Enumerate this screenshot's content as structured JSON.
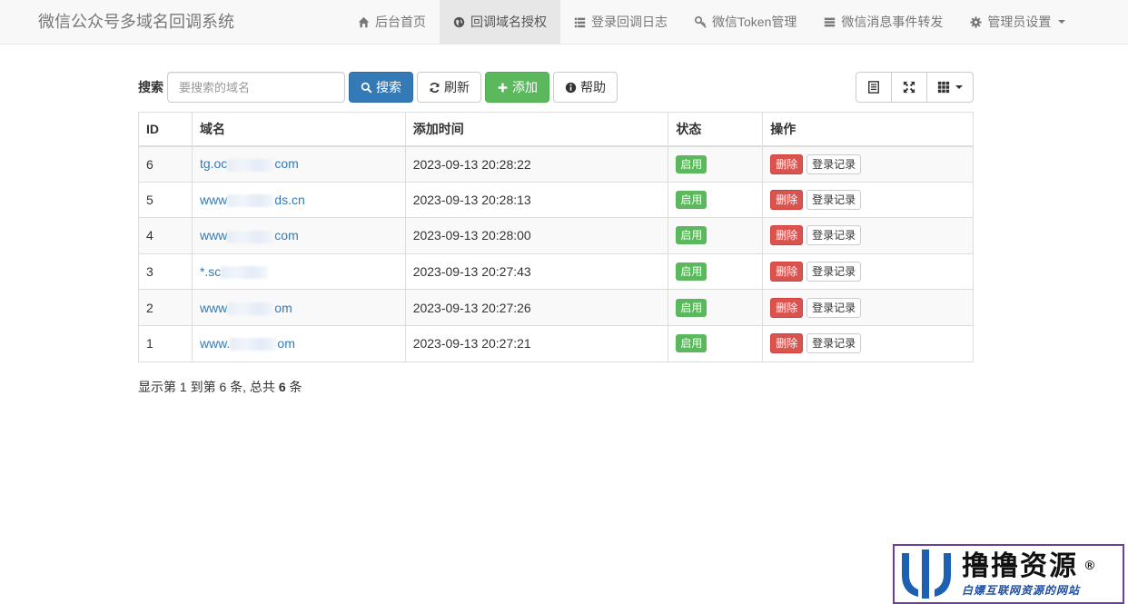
{
  "app": {
    "brand": "微信公众号多域名回调系统"
  },
  "nav": [
    {
      "label": "后台首页",
      "icon": "home-icon",
      "active": false
    },
    {
      "label": "回调域名授权",
      "icon": "globe-icon",
      "active": true
    },
    {
      "label": "登录回调日志",
      "icon": "list-icon",
      "active": false
    },
    {
      "label": "微信Token管理",
      "icon": "key-icon",
      "active": false
    },
    {
      "label": "微信消息事件转发",
      "icon": "server-icon",
      "active": false
    },
    {
      "label": "管理员设置",
      "icon": "gear-icon",
      "active": false
    }
  ],
  "toolbar": {
    "search_label": "搜索",
    "search_placeholder": "要搜索的域名",
    "search_btn": "搜索",
    "refresh_btn": "刷新",
    "add_btn": "添加",
    "help_btn": "帮助"
  },
  "table": {
    "headers": [
      "ID",
      "域名",
      "添加时间",
      "状态",
      "操作"
    ],
    "rows": [
      {
        "id": "6",
        "domain_prefix": "tg.oc",
        "domain_suffix": "com",
        "time": "2023-09-13 20:28:22",
        "status": "启用",
        "delete": "删除",
        "log": "登录记录"
      },
      {
        "id": "5",
        "domain_prefix": "www",
        "domain_suffix": "ds.cn",
        "time": "2023-09-13 20:28:13",
        "status": "启用",
        "delete": "删除",
        "log": "登录记录"
      },
      {
        "id": "4",
        "domain_prefix": "www",
        "domain_suffix": "com",
        "time": "2023-09-13 20:28:00",
        "status": "启用",
        "delete": "删除",
        "log": "登录记录"
      },
      {
        "id": "3",
        "domain_prefix": "*.sc",
        "domain_suffix": "",
        "time": "2023-09-13 20:27:43",
        "status": "启用",
        "delete": "删除",
        "log": "登录记录"
      },
      {
        "id": "2",
        "domain_prefix": "www",
        "domain_suffix": "om",
        "time": "2023-09-13 20:27:26",
        "status": "启用",
        "delete": "删除",
        "log": "登录记录"
      },
      {
        "id": "1",
        "domain_prefix": "www.",
        "domain_suffix": "om",
        "time": "2023-09-13 20:27:21",
        "status": "启用",
        "delete": "删除",
        "log": "登录记录"
      }
    ]
  },
  "pagination": {
    "prefix": "显示第 1 到第 6 条, 总共 ",
    "total": "6",
    "suffix": " 条"
  },
  "watermark": {
    "title": "撸撸资源",
    "reg": "®",
    "subtitle": "白嫖互联网资源的网站"
  },
  "colors": {
    "primary": "#337ab7",
    "success": "#5cb85c",
    "danger": "#d9534f"
  }
}
